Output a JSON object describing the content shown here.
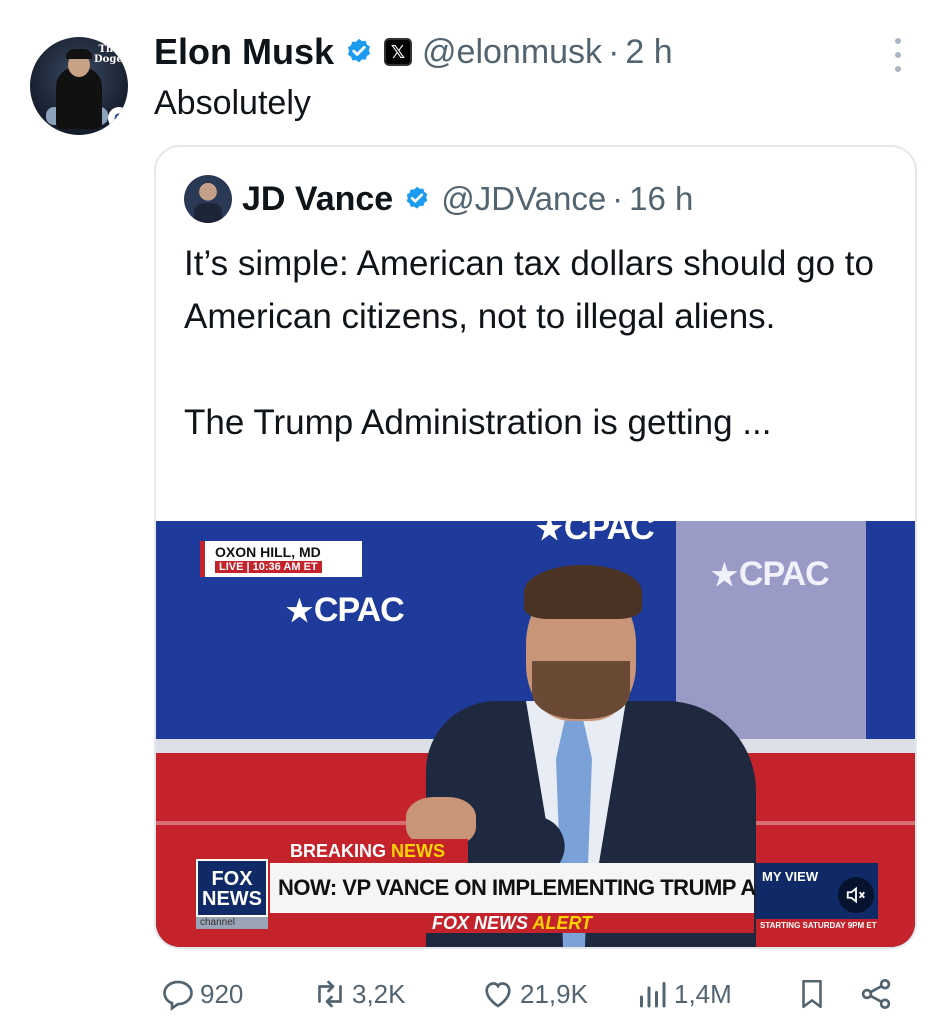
{
  "post": {
    "author_name": "Elon Musk",
    "handle": "@elonmusk",
    "separator": "·",
    "time": "2 h",
    "text": "Absolutely",
    "x_badge": "𝕏"
  },
  "quote": {
    "author_name": "JD Vance",
    "handle": "@JDVance",
    "separator": "·",
    "time": "16 h",
    "paragraph1": "It’s simple: American tax dollars should go to American citizens, not to illegal aliens.",
    "paragraph2": "The Trump Administration is getting ..."
  },
  "video": {
    "location": "OXON HILL, MD",
    "live": "LIVE | 10:36 AM ET",
    "cpac_label": "CPAC",
    "breaking_white": "BREAKING",
    "breaking_yellow": "NEWS",
    "fox_logo": "FOX NEWS",
    "fox_channel": "channel",
    "headline": "NOW: VP VANCE ON IMPLEMENTING TRUMP AGENDA",
    "alert_white": "FOX NEWS",
    "alert_yellow": "ALERT",
    "myview": "MY VIEW",
    "starting": "STARTING SATURDAY 9PM ET",
    "avatar_logo": "The Dogefa",
    "avatar_badge": "C"
  },
  "stats": {
    "replies": "920",
    "reposts": "3,2K",
    "likes": "21,9K",
    "views": "1,4M"
  },
  "colors": {
    "verified_blue": "#1d9bf0",
    "secondary_text": "#536471",
    "fox_red": "#c4232b",
    "cpac_blue": "#1e3b9c"
  },
  "icons": [
    "verified-icon",
    "x-logo-icon",
    "more-icon",
    "reply-icon",
    "repost-icon",
    "like-icon",
    "views-icon",
    "bookmark-icon",
    "share-icon",
    "mute-icon"
  ]
}
